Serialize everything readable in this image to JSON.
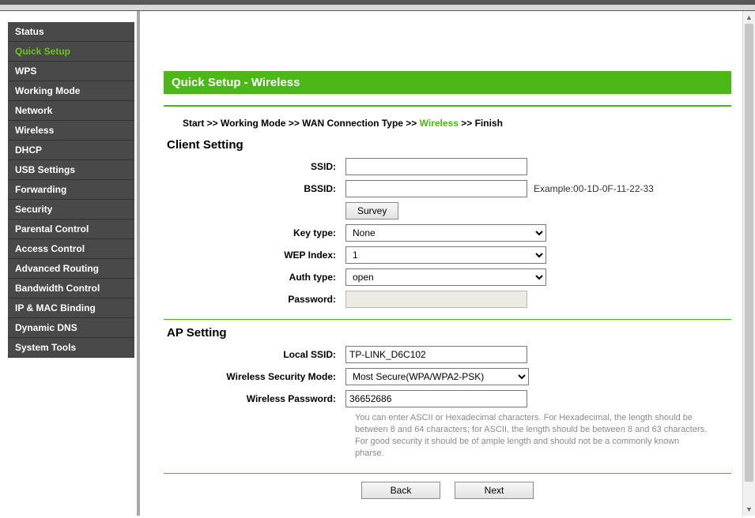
{
  "sidebar": {
    "items": [
      {
        "label": "Status"
      },
      {
        "label": "Quick Setup"
      },
      {
        "label": "WPS"
      },
      {
        "label": "Working Mode"
      },
      {
        "label": "Network"
      },
      {
        "label": "Wireless"
      },
      {
        "label": "DHCP"
      },
      {
        "label": "USB Settings"
      },
      {
        "label": "Forwarding"
      },
      {
        "label": "Security"
      },
      {
        "label": "Parental Control"
      },
      {
        "label": "Access Control"
      },
      {
        "label": "Advanced Routing"
      },
      {
        "label": "Bandwidth Control"
      },
      {
        "label": "IP & MAC Binding"
      },
      {
        "label": "Dynamic DNS"
      },
      {
        "label": "System Tools"
      }
    ],
    "active_index": 1
  },
  "page": {
    "title": "Quick Setup - Wireless"
  },
  "breadcrumb": {
    "sep": " >> ",
    "steps": [
      "Start",
      "Working Mode",
      "WAN Connection Type",
      "Wireless",
      "Finish"
    ],
    "active_step": "Wireless"
  },
  "client": {
    "section_title": "Client Setting",
    "ssid_label": "SSID:",
    "ssid_value": "",
    "bssid_label": "BSSID:",
    "bssid_value": "",
    "bssid_hint": "Example:00-1D-0F-11-22-33",
    "survey_label": "Survey",
    "keytype_label": "Key type:",
    "keytype_value": "None",
    "wepindex_label": "WEP Index:",
    "wepindex_value": "1",
    "authtype_label": "Auth type:",
    "authtype_value": "open",
    "password_label": "Password:",
    "password_value": ""
  },
  "ap": {
    "section_title": "AP Setting",
    "localssid_label": "Local SSID:",
    "localssid_value": "TP-LINK_D6C102",
    "secmode_label": "Wireless Security Mode:",
    "secmode_value": "Most Secure(WPA/WPA2-PSK)",
    "password_label": "Wireless Password:",
    "password_value": "36652686",
    "help_text": "You can enter ASCII or Hexadecimal characters. For Hexadecimal, the length should be between 8 and 64 characters; for ASCII, the length should be between 8 and 63 characters. For good security it should be of ample length and should not be a commonly known pharse."
  },
  "footer": {
    "back_label": "Back",
    "next_label": "Next"
  }
}
